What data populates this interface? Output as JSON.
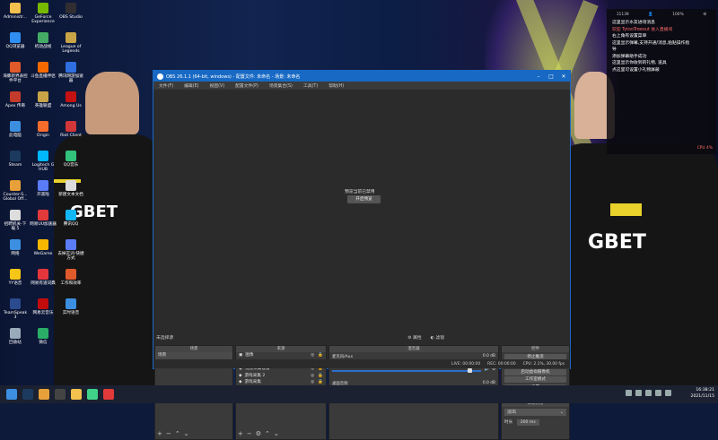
{
  "desktop": {
    "icons": [
      {
        "label": "Administr...",
        "color": "#f2c14e"
      },
      {
        "label": "QQ浏览器",
        "color": "#2f8ef0"
      },
      {
        "label": "海豚新界表控件平台",
        "color": "#e05a2b"
      },
      {
        "label": "Apex 传奇",
        "color": "#c23b2b"
      },
      {
        "label": "此电脑",
        "color": "#3c8fe0"
      },
      {
        "label": "Steam",
        "color": "#1c3a5e"
      },
      {
        "label": "Counter-S... Global Off...",
        "color": "#e8a13a"
      },
      {
        "label": "招聘机关-下载.5",
        "color": "#dddddd"
      },
      {
        "label": "网络",
        "color": "#3c8fe0"
      },
      {
        "label": "YY语音",
        "color": "#f5c518"
      },
      {
        "label": "TeamSpeak 3",
        "color": "#2a4b8d"
      },
      {
        "label": "回收站",
        "color": "#9ab"
      },
      {
        "label": "GeForce Experience",
        "color": "#76b900"
      },
      {
        "label": "机动战线",
        "color": "#4a6"
      },
      {
        "label": "斗鱼直播伴侣",
        "color": "#f56a00"
      },
      {
        "label": "英雄联盟",
        "color": "#c8a447"
      },
      {
        "label": "Origin",
        "color": "#f56c2d"
      },
      {
        "label": "Logitech G HUB",
        "color": "#00b8fc"
      },
      {
        "label": "开黑啦",
        "color": "#5b7cf7"
      },
      {
        "label": "网易UU加速器",
        "color": "#e23a3a"
      },
      {
        "label": "WeGame",
        "color": "#f5b700"
      },
      {
        "label": "网易有道词典",
        "color": "#e5353c"
      },
      {
        "label": "网易云音乐",
        "color": "#c20c0c"
      },
      {
        "label": "微信",
        "color": "#2aae67"
      },
      {
        "label": "OBS Studio",
        "color": "#302e31"
      },
      {
        "label": "League of Legends",
        "color": "#c8a447"
      },
      {
        "label": "腾讯网游加速器",
        "color": "#2f6fe0"
      },
      {
        "label": "Among Us",
        "color": "#c51111"
      },
      {
        "label": "Riot Client",
        "color": "#d13639"
      },
      {
        "label": "QQ音乐",
        "color": "#31c27c"
      },
      {
        "label": "新建文本文档",
        "color": "#dddddd"
      },
      {
        "label": "腾讯QQ",
        "color": "#12b7f5"
      },
      {
        "label": "去掉实训-快捷方式",
        "color": "#5b7cf7"
      },
      {
        "label": "工作和效率",
        "color": "#e05a2b"
      },
      {
        "label": "实时语音",
        "color": "#3c8fe0"
      }
    ]
  },
  "obs": {
    "title": "OBS 26.1.1 (64-bit, windows) - 配置文件: 未命名 - 场景: 未命名",
    "menu": [
      "文件(F)",
      "编辑(E)",
      "视图(V)",
      "配置文件(P)",
      "场景集合(S)",
      "工具(T)",
      "帮助(H)"
    ],
    "preview_message": "预览当前已禁用",
    "preview_button": "开启预览",
    "status_label": "未选择源",
    "props_label": "属性",
    "filters_label": "滤镜",
    "docks": {
      "scenes": {
        "title": "场景",
        "items": [
          "场景"
        ]
      },
      "sources": {
        "title": "来源",
        "items": [
          {
            "label": "图像",
            "icon": "image-icon"
          },
          {
            "label": "文本 (GDI+)",
            "icon": "text-icon"
          },
          {
            "label": "视频采集设备",
            "icon": "camera-icon"
          },
          {
            "label": "游戏采集 2",
            "icon": "gamepad-icon"
          },
          {
            "label": "游戏采集",
            "icon": "gamepad-icon"
          },
          {
            "label": "显示器采集",
            "icon": "monitor-icon"
          }
        ]
      },
      "mixer": {
        "title": "混音器",
        "channels": [
          {
            "name": "麦克风/Aux",
            "db": "0.0 dB",
            "level": 0.05
          },
          {
            "name": "桌面音频",
            "db": "0.0 dB",
            "level": 0.15
          }
        ]
      },
      "controls": {
        "title": "控件",
        "buttons": [
          "停止推流",
          "开始录制",
          "启动虚拟摄像机",
          "工作室模式",
          "设置",
          "退出"
        ]
      },
      "transitions": {
        "title": "转场特效",
        "selected": "淡出",
        "duration_label": "时长",
        "duration_value": "300 ms"
      }
    },
    "statusbar": {
      "live": "LIVE: 00:00:00",
      "rec": "REC: 00:00:00",
      "cpu": "CPU: 2.1%, 30.00 fps"
    }
  },
  "chat": {
    "topbar": [
      "11139",
      "👤",
      "100%",
      "⚙"
    ],
    "lines": [
      {
        "text": "这里显示水友进场消息",
        "hi": false
      },
      {
        "text": "欢迎 TytooTreeout 进入直播间",
        "hi": true
      },
      {
        "text": "右上角有设置菜单",
        "hi": false
      },
      {
        "text": "这里显示弹幕,支持开通/消息,粘贴操作指",
        "hi": false
      },
      {
        "text": "导",
        "hi": false
      },
      {
        "text": "添加弹幕助手成功",
        "hi": false
      },
      {
        "text": "这里显示你收到的礼物, 道具",
        "hi": false
      },
      {
        "text": "点这里可设置小礼物屏蔽",
        "hi": false
      }
    ],
    "footer": "CPU 4%"
  },
  "taskbar": {
    "clock": "16:38:21",
    "date": "2021/11/15",
    "apps": [
      {
        "name": "windows-start-icon",
        "color": "#3c8fe0"
      },
      {
        "name": "steam-taskbar-icon",
        "color": "#1c3a5e"
      },
      {
        "name": "cs-taskbar-icon",
        "color": "#e8a13a"
      },
      {
        "name": "obs-taskbar-icon",
        "color": "#444444"
      },
      {
        "name": "folder-taskbar-icon",
        "color": "#f2c14e"
      },
      {
        "name": "kaiheila-taskbar-icon",
        "color": "#3fd38a"
      },
      {
        "name": "netease-taskbar-icon",
        "color": "#e23a3a"
      }
    ]
  }
}
